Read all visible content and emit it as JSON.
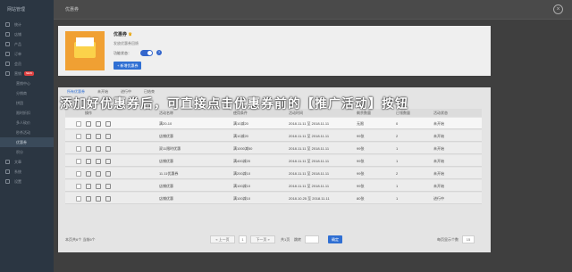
{
  "sidebar": {
    "title": "网站管理",
    "items": [
      {
        "label": "统计"
      },
      {
        "label": "店铺"
      },
      {
        "label": "产品"
      },
      {
        "label": "订单"
      },
      {
        "label": "会员"
      },
      {
        "label": "营销",
        "badge": "NEW"
      },
      {
        "label": "营销中心",
        "sub": true
      },
      {
        "label": "分销商",
        "sub": true
      },
      {
        "label": "拼团",
        "sub": true
      },
      {
        "label": "限时折扣",
        "sub": true
      },
      {
        "label": "多人砍价",
        "sub": true
      },
      {
        "label": "秒杀活动",
        "sub": true
      },
      {
        "label": "优惠券",
        "sub": true,
        "active": true
      },
      {
        "label": "积分",
        "sub": true
      },
      {
        "label": "文章"
      },
      {
        "label": "系统"
      },
      {
        "label": "设置"
      }
    ]
  },
  "header": {
    "title": "优惠券"
  },
  "app": {
    "name": "优惠券",
    "desc": "发放优惠券回馈",
    "switch_label": "功能状态：",
    "create_label": "+ 新增优惠券"
  },
  "tabs": [
    "所有优惠券",
    "未开始",
    "进行中",
    "已结束"
  ],
  "table": {
    "headers": [
      "操作",
      "活动名称",
      "使用条件",
      "活动时间",
      "剩余数量",
      "已领数量",
      "活动状态"
    ],
    "rows": [
      {
        "name": "满20-10",
        "cond": "满10减20",
        "time": "2018.11.11 至 2018.11.11",
        "left": "无限",
        "taken": "0",
        "status": "未开始"
      },
      {
        "name": "店铺优惠",
        "cond": "满10减20",
        "time": "2018.11.11 至 2018.11.11",
        "left": "99张",
        "taken": "2",
        "status": "未开始"
      },
      {
        "name": "双11限时优惠",
        "cond": "满1000减50",
        "time": "2018.11.11 至 2018.11.11",
        "left": "99张",
        "taken": "1",
        "status": "未开始"
      },
      {
        "name": "店铺优惠",
        "cond": "满400减20",
        "time": "2018.11.11 至 2018.11.11",
        "left": "99张",
        "taken": "1",
        "status": "未开始"
      },
      {
        "name": "11.11优惠券",
        "cond": "满200减10",
        "time": "2018.11.11 至 2018.11.11",
        "left": "99张",
        "taken": "2",
        "status": "未开始"
      },
      {
        "name": "店铺优惠",
        "cond": "满100减10",
        "time": "2018.11.11 至 2018.11.11",
        "left": "99张",
        "taken": "1",
        "status": "未开始"
      },
      {
        "name": "店铺优惠",
        "cond": "满100减10",
        "time": "2018.10.25 至 2018.11.11",
        "left": "80张",
        "taken": "1",
        "status": "进行中"
      }
    ]
  },
  "pager": {
    "select_all": "本页共6个  当前6个",
    "prev": "« 上一页",
    "page": "1",
    "next": "下一页 »",
    "total": "共1页",
    "goto": "跳转",
    "go_btn": "确定",
    "per_page_label": "每页显示个数",
    "per_page": "15"
  },
  "banner": "添加好优惠券后，可直接点击优惠券前的【推广活动】按钮"
}
